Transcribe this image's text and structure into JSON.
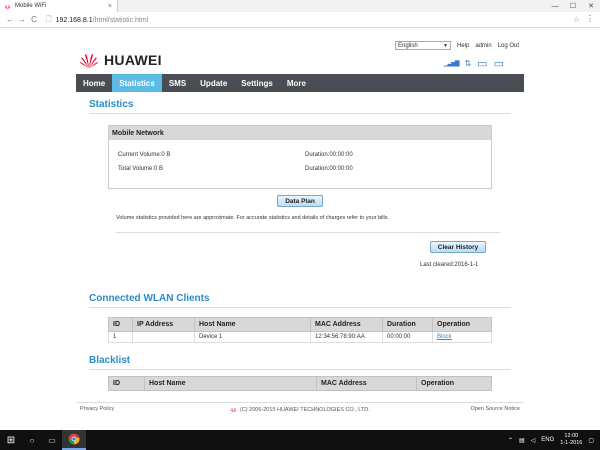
{
  "browser": {
    "tab_title": "Mobile WiFi",
    "tab_close": "×",
    "url_host": "192.168.8.1",
    "url_path": "/html/statistic.html",
    "back_glyph": "←",
    "forward_glyph": "→",
    "reload_glyph": "C",
    "page_glyph": "🗋",
    "star_glyph": "☆",
    "menu_glyph": "⋮",
    "min_glyph": "—",
    "max_glyph": "☐",
    "close_glyph": "✕"
  },
  "header": {
    "language": "English",
    "help": "Help",
    "user": "admin",
    "logout": "Log Out",
    "brand": "HUAWEI",
    "status_icons": [
      "signal-icon",
      "data-transfer-icon",
      "monitor-icon",
      "battery-icon"
    ],
    "signal_glyph": "▁▃▅▇",
    "transfer_glyph": "⇅",
    "monitor_glyph": "▭",
    "battery_glyph": "▭"
  },
  "nav": {
    "items": [
      "Home",
      "Statistics",
      "SMS",
      "Update",
      "Settings",
      "More"
    ],
    "active": "Statistics"
  },
  "statistics": {
    "title": "Statistics",
    "panel_title": "Mobile Network",
    "current_volume": "Current Volume:0 B",
    "current_duration": "Duration:00:00:00",
    "total_volume": "Total Volume:0 B",
    "total_duration": "Duration:00:00:00",
    "data_plan_button": "Data Plan",
    "note": "Volume statistics provided here are approximate. For accurate statistics and details of charges refer to your bills.",
    "clear_history_button": "Clear History",
    "last_cleared": "Last cleared:2016-1-1"
  },
  "wlan": {
    "title": "Connected WLAN Clients",
    "columns": [
      "ID",
      "IP Address",
      "Host Name",
      "MAC Address",
      "Duration",
      "Operation"
    ],
    "rows": [
      {
        "id": "1",
        "ip": "",
        "host": "Device 1",
        "mac": "12:34:56:78:90:AA",
        "duration": "00:00:00",
        "operation": "Block"
      }
    ]
  },
  "blacklist": {
    "title": "Blacklist",
    "columns": [
      "ID",
      "Host Name",
      "MAC Address",
      "Operation"
    ]
  },
  "footer": {
    "privacy": "Privacy Policy",
    "copyright": "(C) 2006-2015 HUAWEI TECHNOLOGIES CO., LTD.",
    "open_source": "Open Source Notice"
  },
  "taskbar": {
    "start_glyph": "⊞",
    "search_glyph": "○",
    "taskview_glyph": "▭",
    "lang": "ENG",
    "time": "12:00",
    "date": "1-1-2016"
  },
  "colors": {
    "accent": "#2a8cc8",
    "nav_bg": "#4a4e54",
    "nav_active": "#5bbbe6",
    "huawei_red": "#e4002b"
  }
}
